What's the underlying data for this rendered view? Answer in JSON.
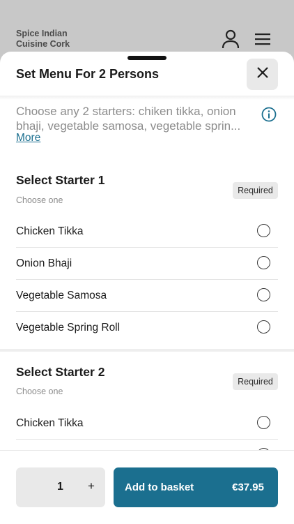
{
  "background": {
    "brand_name": "Spice Indian Cuisine Cork"
  },
  "sheet": {
    "title": "Set Menu For 2 Persons",
    "description": "Choose any 2 starters: chiken tikka, onion bhaji, vegetable samosa, vegetable sprin...",
    "more_label": "More"
  },
  "groups": [
    {
      "title": "Select Starter 1",
      "subtitle": "Choose one",
      "badge": "Required",
      "options": [
        "Chicken Tikka",
        "Onion Bhaji",
        "Vegetable Samosa",
        "Vegetable Spring Roll"
      ]
    },
    {
      "title": "Select Starter 2",
      "subtitle": "Choose one",
      "badge": "Required",
      "options": [
        "Chicken Tikka"
      ]
    }
  ],
  "footer": {
    "quantity": "1",
    "plus_label": "+",
    "add_label": "Add to basket",
    "price": "€37.95"
  },
  "colors": {
    "accent": "#1b6f8f",
    "badge_bg": "#e9e9e9"
  }
}
